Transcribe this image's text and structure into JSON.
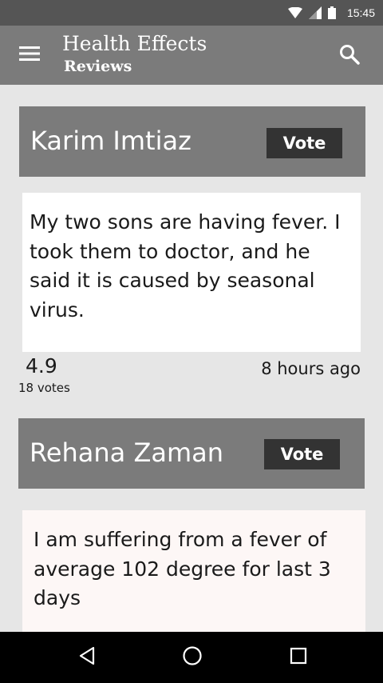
{
  "status_bar": {
    "time": "15:45",
    "icons": [
      "wifi-icon",
      "signal-icon",
      "battery-icon"
    ]
  },
  "app_bar": {
    "title": "Health Effects",
    "subtitle": "Reviews",
    "menu_icon": "menu-icon",
    "search_icon": "search-icon"
  },
  "reviews": [
    {
      "name": "Karim Imtiaz",
      "vote_label": "Vote",
      "text": "My two sons are having fever. I took them to doctor, and he said it is caused by seasonal virus.",
      "rating": "4.9",
      "votes": "18 votes",
      "time": "8 hours ago"
    },
    {
      "name": "Rehana Zaman",
      "vote_label": "Vote",
      "text": "I am suffering from a fever of average 102 degree for last 3 days"
    }
  ],
  "nav_bar": {
    "icons": [
      "back-icon",
      "home-icon",
      "recents-icon"
    ]
  },
  "colors": {
    "status_bar": "#555555",
    "app_bar": "#7b7b7b",
    "background": "#e6e6e6",
    "vote_button": "#333333",
    "card_1": "#ffffff",
    "card_2": "#fdf7f6",
    "nav_bar": "#000000"
  }
}
